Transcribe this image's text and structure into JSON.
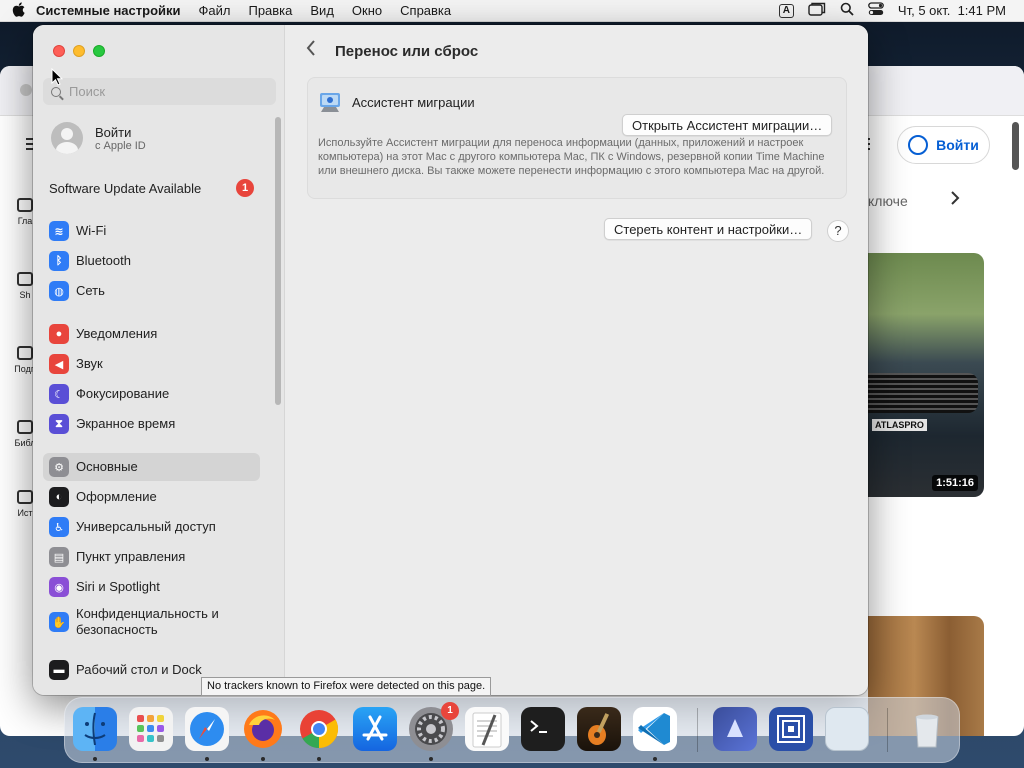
{
  "menubar": {
    "app_name": "Системные настройки",
    "menus": [
      "Файл",
      "Правка",
      "Вид",
      "Окно",
      "Справка"
    ],
    "input_indicator": "A",
    "clock": "Чт, 5 окт.  1:41 PM"
  },
  "background_window": {
    "login_label": "Войти",
    "chip_text": "ключе",
    "duration": "1:51:16",
    "atlas_badge": "ATLASPRO",
    "side_labels": [
      "Гла",
      "Sh",
      "Подп",
      "Библ",
      "Ист"
    ]
  },
  "settings": {
    "search_placeholder": "Поиск",
    "account": {
      "title": "Войти",
      "subtitle": "с Apple ID"
    },
    "software_update": {
      "label": "Software Update Available",
      "badge": "1"
    },
    "sidebar_items": [
      {
        "label": "Wi-Fi",
        "icon": "wifi-icon",
        "color": "#2f7cf6"
      },
      {
        "label": "Bluetooth",
        "icon": "bluetooth-icon",
        "color": "#2f7cf6"
      },
      {
        "label": "Сеть",
        "icon": "globe-icon",
        "color": "#2f7cf6"
      },
      {
        "label": "Уведомления",
        "icon": "bell-icon",
        "color": "#e8453c"
      },
      {
        "label": "Звук",
        "icon": "speaker-icon",
        "color": "#e8453c"
      },
      {
        "label": "Фокусирование",
        "icon": "moon-icon",
        "color": "#5a4fd6"
      },
      {
        "label": "Экранное время",
        "icon": "hourglass-icon",
        "color": "#5a4fd6"
      },
      {
        "label": "Основные",
        "icon": "gear-icon",
        "color": "#8e8e93",
        "selected": true
      },
      {
        "label": "Оформление",
        "icon": "appearance-icon",
        "color": "#1c1c1e"
      },
      {
        "label": "Универсальный доступ",
        "icon": "accessibility-icon",
        "color": "#2f7cf6"
      },
      {
        "label": "Пункт управления",
        "icon": "control-center-icon",
        "color": "#8e8e93"
      },
      {
        "label": "Siri и Spotlight",
        "icon": "siri-icon",
        "color": "#8a4fd6"
      },
      {
        "label": "Конфиденциальность и безопасность",
        "icon": "hand-icon",
        "color": "#2f7cf6"
      },
      {
        "label": "Рабочий стол и Dock",
        "icon": "dock-icon",
        "color": "#1c1c1e"
      }
    ],
    "page_title": "Перенос или сброс",
    "migration": {
      "title": "Ассистент миграции",
      "button": "Открыть Ассистент миграции…",
      "description": "Используйте Ассистент миграции для переноса информации (данных, приложений и настроек компьютера) на этот Mac с другого компьютера Mac, ПК с Windows, резервной копии Time Machine или внешнего диска. Вы также можете перенести информацию с этого компьютера Mac на другой."
    },
    "erase_button": "Стереть контент и настройки…",
    "help_button": "?"
  },
  "tooltip": "No trackers known to Firefox were detected on this page.",
  "dock": {
    "items": [
      {
        "name": "finder-icon",
        "running": true
      },
      {
        "name": "launchpad-icon",
        "running": false
      },
      {
        "name": "safari-icon",
        "running": true
      },
      {
        "name": "firefox-icon",
        "running": true
      },
      {
        "name": "chrome-icon",
        "running": true
      },
      {
        "name": "app-store-icon",
        "running": false
      },
      {
        "name": "system-settings-icon",
        "running": true,
        "badge": "1"
      },
      {
        "name": "textedit-icon",
        "running": false
      },
      {
        "name": "terminal-icon",
        "running": false
      },
      {
        "name": "garageband-icon",
        "running": false
      },
      {
        "name": "vscode-icon",
        "running": true
      },
      {
        "name": "app-folder-icon",
        "running": false
      },
      {
        "name": "screen-sharing-icon",
        "running": false
      },
      {
        "name": "blank-window-icon",
        "running": false
      },
      {
        "name": "trash-icon",
        "running": false
      }
    ]
  }
}
